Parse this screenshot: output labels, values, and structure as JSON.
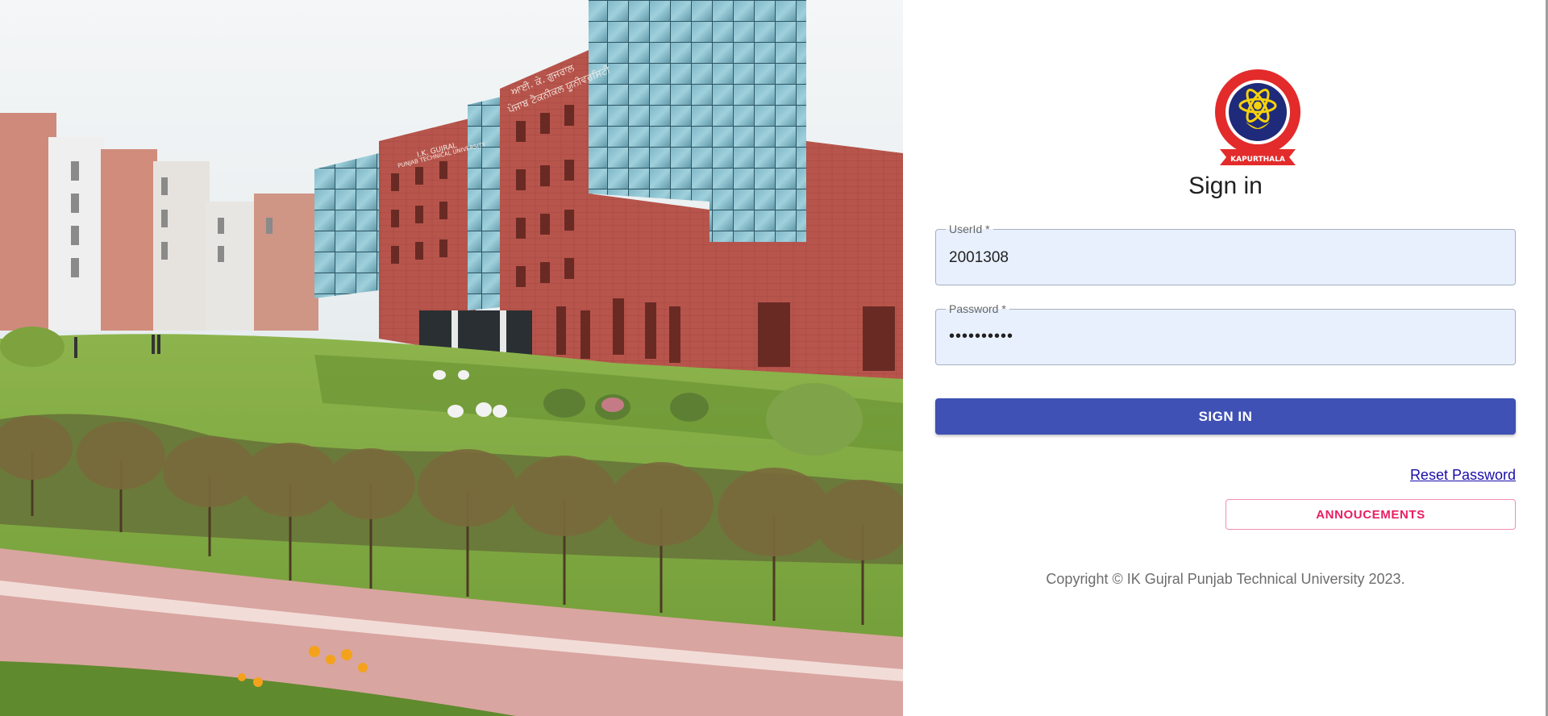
{
  "hero": {
    "sign_left": "I.K. GUJRAL",
    "sign_left_sub": "PUNJAB TECHNICAL UNIVERSITY",
    "sign_right": "ਆਈ. ਕੇ. ਗੁਜਰਾਲ",
    "sign_right_sub": "ਪੰਜਾਬ ਟੈਕਨੀਕਲ ਯੂਨੀਵਰਸਿਟੀ"
  },
  "logo": {
    "icon": "university-logo",
    "ribbon_text": "KAPURTHALA"
  },
  "title": "Sign in",
  "userid": {
    "label": "UserId *",
    "value": "2001308"
  },
  "password": {
    "label": "Password *",
    "value": "••••••••••"
  },
  "signin_button": "SIGN IN",
  "reset_link": "Reset Password",
  "announcements_button": "ANNOUCEMENTS",
  "copyright": "Copyright © IK Gujral Punjab Technical University 2023.",
  "colors": {
    "primary": "#3f51b5",
    "secondary": "#e91e63",
    "field_bg": "#e8f0fe",
    "link": "#1a0dab"
  }
}
